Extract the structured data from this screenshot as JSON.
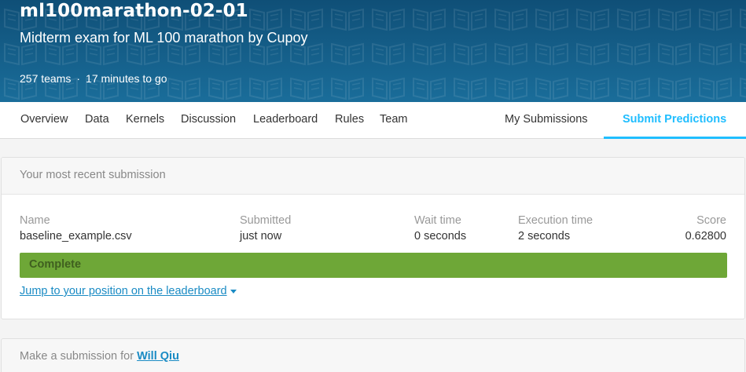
{
  "competition": {
    "title": "ml100marathon-02-01",
    "subtitle": "Midterm exam for ML 100 marathon by Cupoy",
    "teams": "257 teams",
    "separator": "·",
    "time_left": "17 minutes to go"
  },
  "nav": {
    "tabs": [
      "Overview",
      "Data",
      "Kernels",
      "Discussion",
      "Leaderboard",
      "Rules",
      "Team"
    ],
    "my_submissions": "My Submissions",
    "submit_predictions": "Submit Predictions",
    "active_tab": "Submit Predictions"
  },
  "recent_submission": {
    "heading": "Your most recent submission",
    "columns": {
      "name": "Name",
      "submitted": "Submitted",
      "wait_time": "Wait time",
      "execution_time": "Execution time",
      "score": "Score"
    },
    "row": {
      "name": "baseline_example.csv",
      "submitted": "just now",
      "wait_time": "0 seconds",
      "execution_time": "2 seconds",
      "score": "0.62800"
    },
    "status": "Complete",
    "jump_link": "Jump to your position on the leaderboard"
  },
  "make_submission": {
    "prefix": "Make a submission for ",
    "user": "Will Qiu"
  },
  "colors": {
    "header_bg": "#155d87",
    "accent": "#20beff",
    "status_green": "#6ea737",
    "link": "#1a8bc4"
  }
}
